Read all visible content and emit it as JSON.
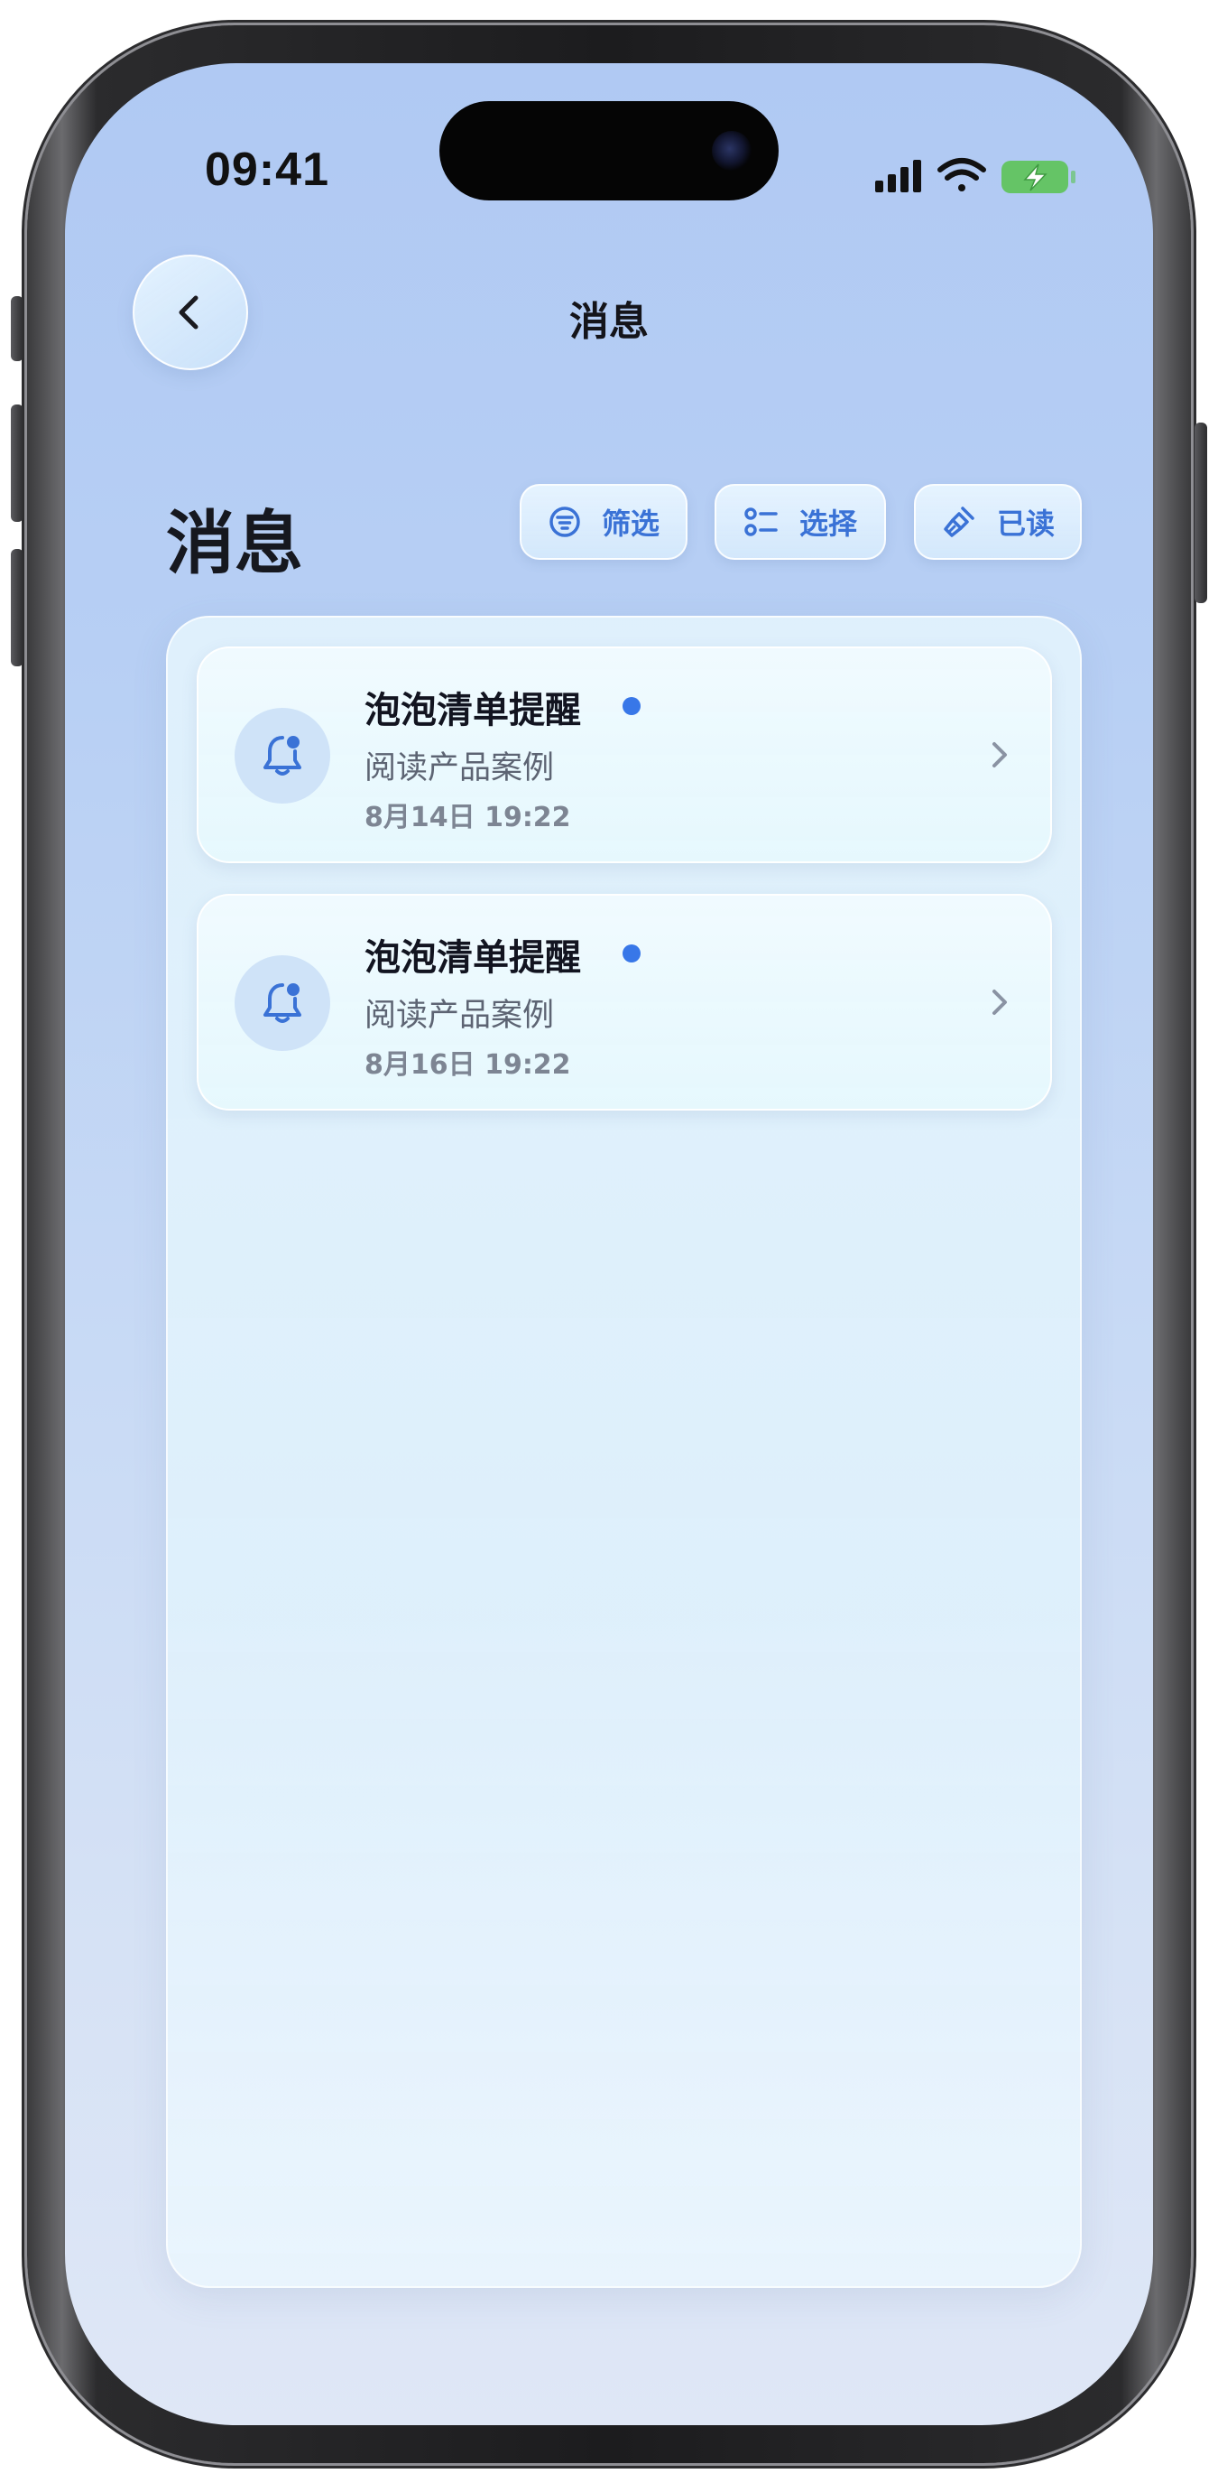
{
  "status_bar": {
    "time": "09:41"
  },
  "nav": {
    "title": "消息",
    "back_icon": "chevron-left-icon"
  },
  "header": {
    "title": "消息",
    "actions": [
      {
        "label": "筛选",
        "icon": "filter-icon"
      },
      {
        "label": "选择",
        "icon": "select-list-icon"
      },
      {
        "label": "已读",
        "icon": "broom-icon"
      }
    ]
  },
  "messages": [
    {
      "title": "泡泡清单提醒",
      "subtitle": "阅读产品案例",
      "time": "8月14日 19:22",
      "unread": true,
      "icon": "bell-icon"
    },
    {
      "title": "泡泡清单提醒",
      "subtitle": "阅读产品案例",
      "time": "8月16日 19:22",
      "unread": true,
      "icon": "bell-icon"
    }
  ],
  "colors": {
    "accent": "#3a72d6",
    "unread_dot": "#3877e8",
    "battery": "#65c466"
  }
}
